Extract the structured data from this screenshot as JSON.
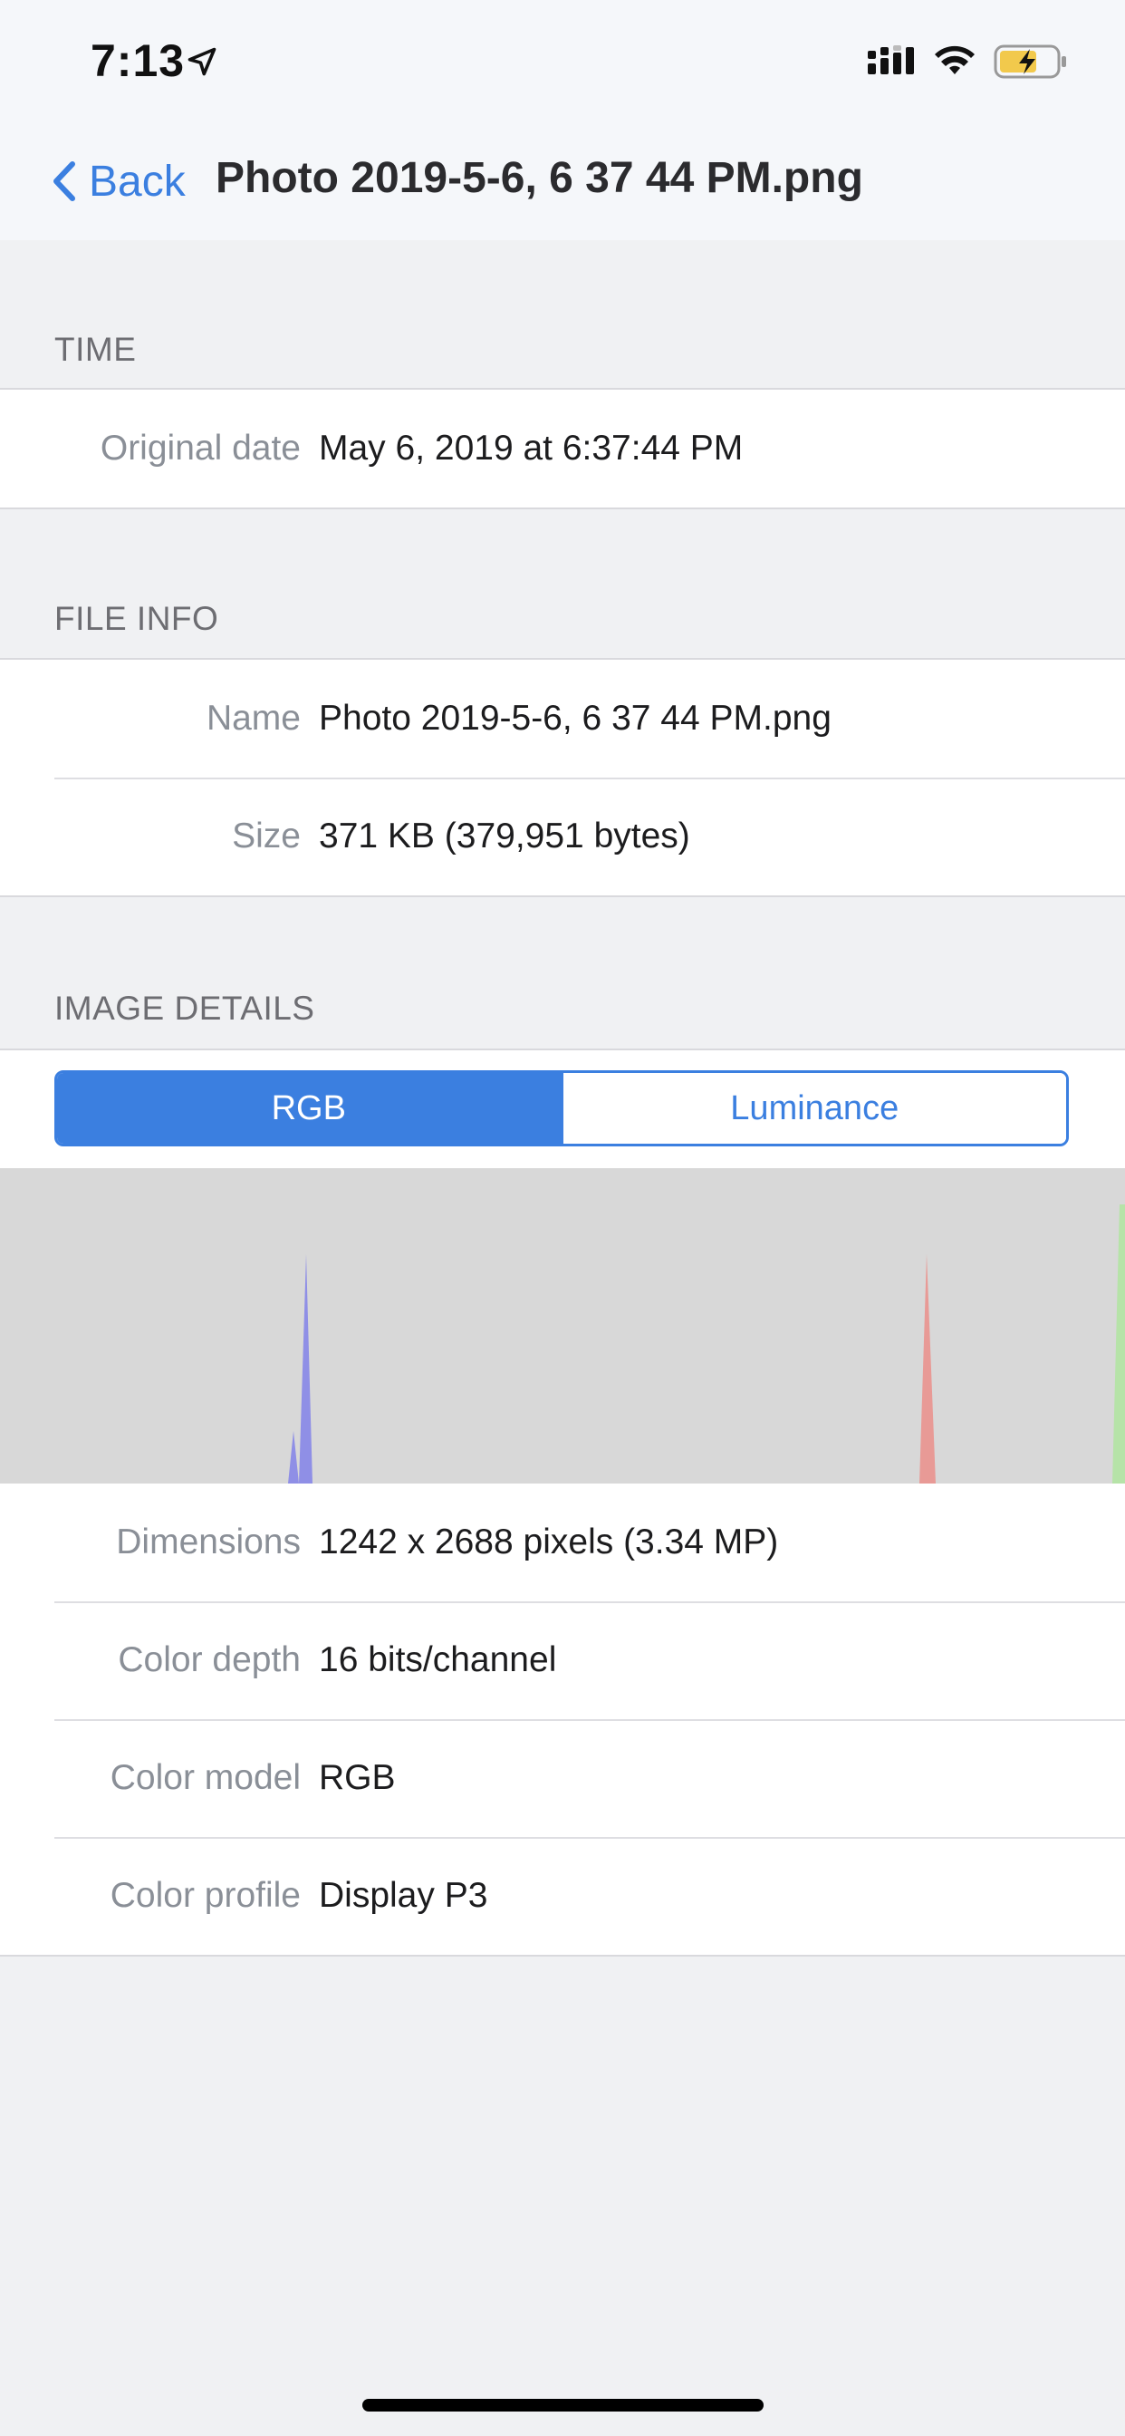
{
  "status_bar": {
    "time": "7:13",
    "icons": [
      "location-arrow-icon",
      "cellular-signal-icon",
      "wifi-icon",
      "battery-charging-icon"
    ],
    "battery_color": "#f2c94c"
  },
  "nav": {
    "back_label": "Back",
    "title": "Photo 2019-5-6, 6 37 44 PM.png"
  },
  "sections": {
    "time": {
      "header": "TIME",
      "rows": [
        {
          "label": "Original date",
          "value": "May 6, 2019 at 6:37:44 PM"
        }
      ]
    },
    "file_info": {
      "header": "FILE INFO",
      "rows": [
        {
          "label": "Name",
          "value": "Photo 2019-5-6, 6 37 44 PM.png"
        },
        {
          "label": "Size",
          "value": "371 KB (379,951 bytes)"
        }
      ]
    },
    "image_details": {
      "header": "IMAGE DETAILS",
      "segments": [
        {
          "label": "RGB",
          "selected": true
        },
        {
          "label": "Luminance",
          "selected": false
        }
      ],
      "rows": [
        {
          "label": "Dimensions",
          "value": "1242 x 2688 pixels (3.34 MP)"
        },
        {
          "label": "Color depth",
          "value": "16 bits/channel"
        },
        {
          "label": "Color model",
          "value": "RGB"
        },
        {
          "label": "Color profile",
          "value": "Display P3"
        }
      ]
    }
  },
  "colors": {
    "accent": "#3b7fe0",
    "histogram_blue": "#8f8fe6",
    "histogram_red": "#e89a96",
    "histogram_green": "#b6e3a8"
  }
}
